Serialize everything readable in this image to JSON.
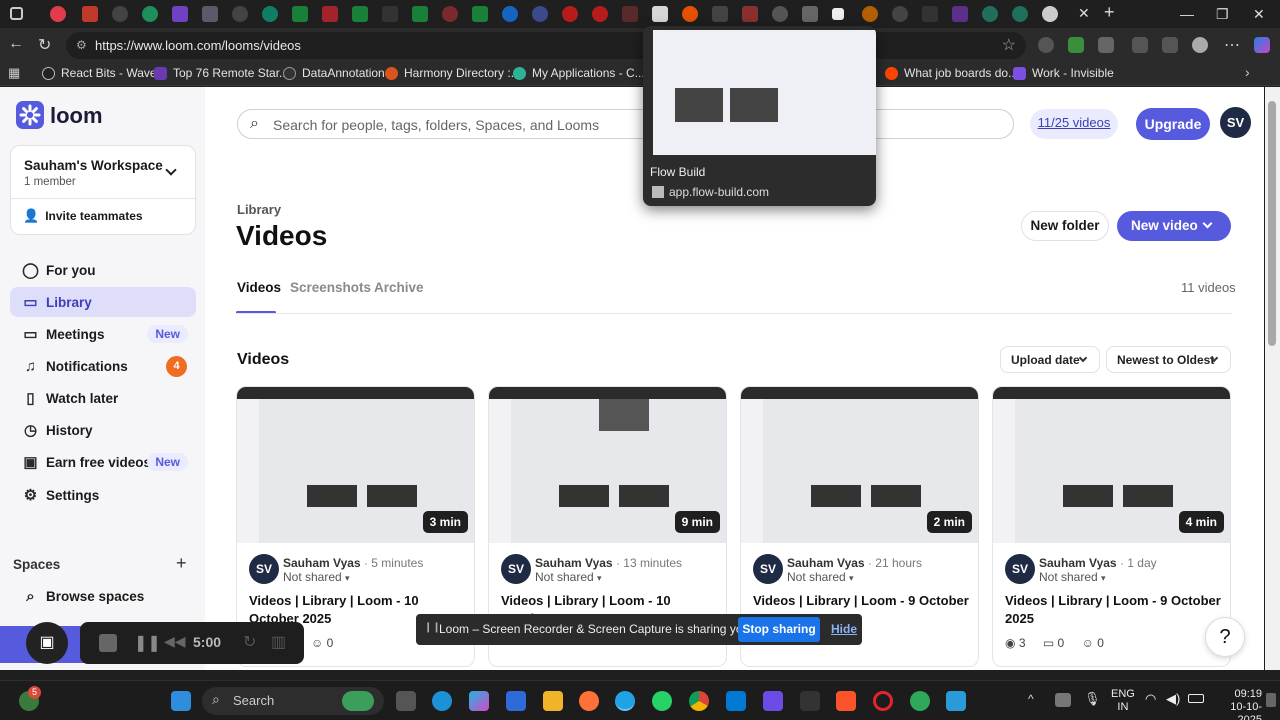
{
  "browser": {
    "url": "https://www.loom.com/looms/videos",
    "bookmarks": [
      {
        "label": "React Bits - Waves",
        "icon": "react-icon"
      },
      {
        "label": "Top 76 Remote Star...",
        "icon": "ts-icon"
      },
      {
        "label": "DataAnnotation",
        "icon": "person-icon"
      },
      {
        "label": "Harmony Directory :...",
        "icon": "harmony-icon"
      },
      {
        "label": "My Applications - C...",
        "icon": "chat-icon"
      },
      {
        "label": "What job boards do...",
        "icon": "reddit-icon"
      },
      {
        "label": "Work - Invisible",
        "icon": "work-icon"
      }
    ]
  },
  "tab_preview": {
    "title": "Flow Build",
    "url": "app.flow-build.com"
  },
  "sidebar": {
    "logo": "loom",
    "workspace_name": "Sauham's Workspace",
    "workspace_members": "1 member",
    "invite_label": "Invite teammates",
    "items": [
      {
        "label": "For you",
        "icon": "person-icon"
      },
      {
        "label": "Library",
        "icon": "library-icon",
        "active": true
      },
      {
        "label": "Meetings",
        "icon": "meetings-icon",
        "tag": "New"
      },
      {
        "label": "Notifications",
        "icon": "bell-icon",
        "badge": "4"
      },
      {
        "label": "Watch later",
        "icon": "bookmark-icon"
      },
      {
        "label": "History",
        "icon": "history-icon"
      },
      {
        "label": "Earn free videos",
        "icon": "gift-icon",
        "tag": "New"
      },
      {
        "label": "Settings",
        "icon": "gear-icon"
      }
    ],
    "spaces_heading": "Spaces",
    "browse_spaces": "Browse spaces"
  },
  "header": {
    "search_placeholder": "Search for people, tags, folders, Spaces, and Looms",
    "video_quota": "11/25 videos",
    "upgrade_label": "Upgrade",
    "avatar_initials": "SV"
  },
  "library": {
    "breadcrumb": "Library",
    "title": "Videos",
    "new_folder_label": "New folder",
    "new_video_label": "New video",
    "tabs": [
      "Videos",
      "Screenshots",
      "Archive"
    ],
    "video_count": "11 videos",
    "section_title": "Videos",
    "sort_field": "Upload date",
    "sort_order": "Newest to Oldest"
  },
  "videos": [
    {
      "duration": "3 min",
      "author": "Sauham Vyas",
      "age": "5 minutes",
      "sharing": "Not shared",
      "title": "Videos | Library | Loom - 10 October 2025",
      "views": "",
      "comments": "0",
      "reactions": "0"
    },
    {
      "duration": "9 min",
      "author": "Sauham Vyas",
      "age": "13 minutes",
      "sharing": "Not shared",
      "title": "Videos | Library | Loom - 10 October",
      "views": "",
      "comments": "",
      "reactions": ""
    },
    {
      "duration": "2 min",
      "author": "Sauham Vyas",
      "age": "21 hours",
      "sharing": "Not shared",
      "title": "Videos | Library | Loom - 9 October",
      "views": "",
      "comments": "",
      "reactions": ""
    },
    {
      "duration": "4 min",
      "author": "Sauham Vyas",
      "age": "1 day",
      "sharing": "Not shared",
      "title": "Videos | Library | Loom - 9 October 2025",
      "views": "3",
      "comments": "0",
      "reactions": "0"
    }
  ],
  "recorder": {
    "timer": "5:00"
  },
  "share_bar": {
    "message": "Loom – Screen Recorder & Screen Capture is sharing your screen.",
    "stop_label": "Stop sharing",
    "hide_label": "Hide"
  },
  "help_label": "?",
  "taskbar": {
    "search_label": "Search",
    "language": "ENG",
    "region": "IN",
    "time": "09:19",
    "date": "10-10-2025",
    "notification_count": "5"
  },
  "colors": {
    "accent": "#565add",
    "badge": "#ee6d22"
  }
}
